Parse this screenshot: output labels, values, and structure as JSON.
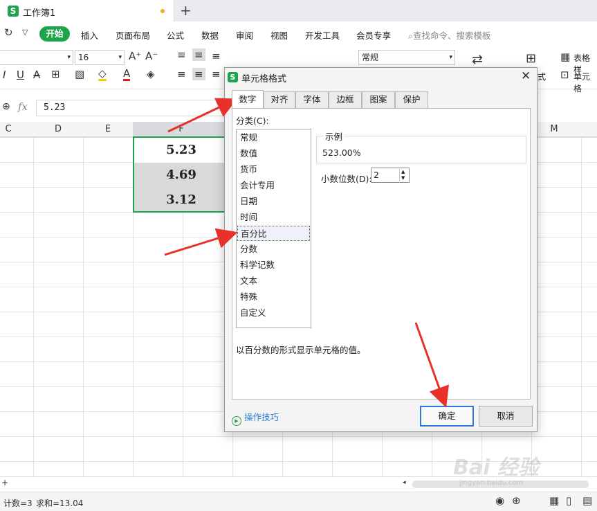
{
  "window": {
    "tab_title": "工作簿1",
    "logo": "S",
    "new_tab": "+"
  },
  "menu": {
    "items": [
      "插入",
      "页面布局",
      "公式",
      "数据",
      "审阅",
      "视图",
      "开发工具",
      "会员专享"
    ],
    "active": "开始",
    "search": "查找命令、搜索模板"
  },
  "toolbar": {
    "font_size": "16",
    "number_format": "常规",
    "table_style_label": "表格样",
    "cell_label": "单元格",
    "style_label": "式"
  },
  "formula_bar": {
    "fx": "fx",
    "value": "5.23"
  },
  "grid": {
    "columns": [
      "C",
      "D",
      "E",
      "F",
      "M"
    ],
    "cells": [
      "5.23",
      "4.69",
      "3.12"
    ]
  },
  "status": {
    "count": "计数=3",
    "sum": "求和=13.04"
  },
  "dialog": {
    "title": "单元格格式",
    "tabs": [
      "数字",
      "对齐",
      "字体",
      "边框",
      "图案",
      "保护"
    ],
    "category_label": "分类(C):",
    "categories": [
      "常规",
      "数值",
      "货币",
      "会计专用",
      "日期",
      "时间",
      "百分比",
      "分数",
      "科学记数",
      "文本",
      "特殊",
      "自定义"
    ],
    "selected_category": "百分比",
    "sample_label": "示例",
    "sample_value": "523.00%",
    "decimal_label": "小数位数(D):",
    "decimal_value": "2",
    "description": "以百分数的形式显示单元格的值。",
    "tips": "操作技巧",
    "ok": "确定",
    "cancel": "取消"
  },
  "watermark": {
    "main": "Bai 经验",
    "sub": "jingyan.baidu.com"
  },
  "colors": {
    "accent": "#1ea34a",
    "arrow": "#e8312a",
    "primary_border": "#2c7ad6"
  }
}
